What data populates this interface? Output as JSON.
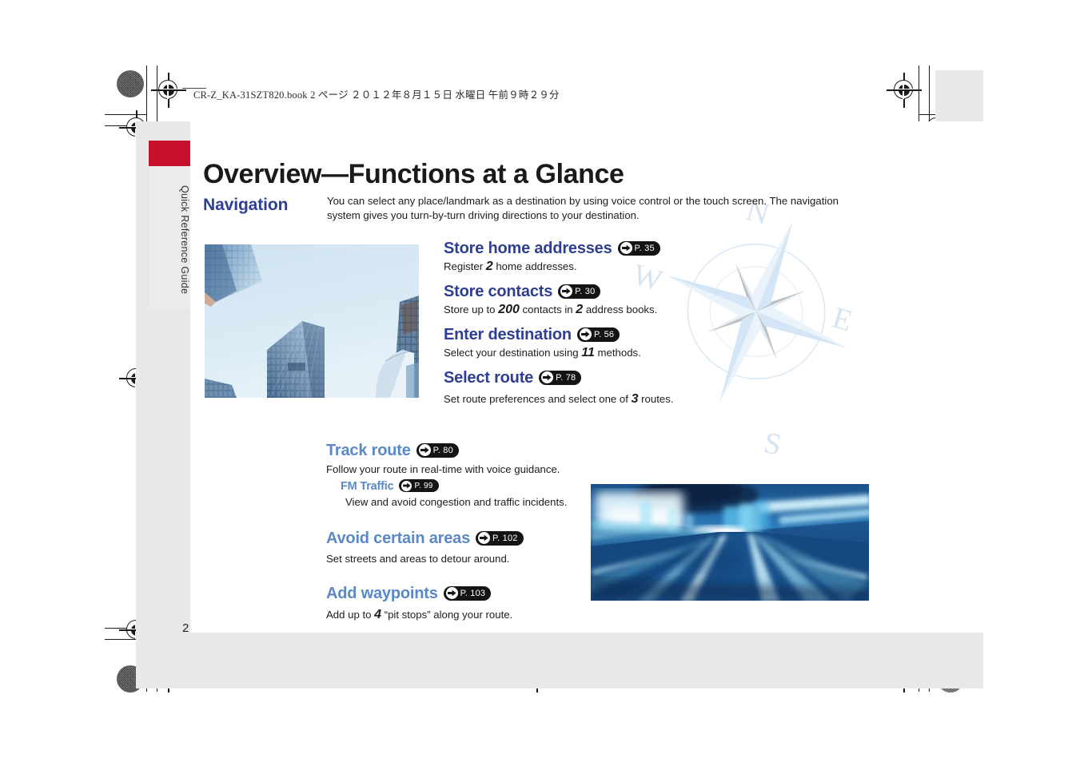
{
  "print_header": "CR-Z_KA-31SZT820.book   2 ページ   ２０１２年８月１５日   水曜日   午前９時２９分",
  "sidetab": {
    "label": "Quick Reference Guide",
    "accent_color": "#c8102e"
  },
  "page": {
    "title": "Overview—Functions at a Glance",
    "number": "2"
  },
  "section": {
    "title": "Navigation",
    "intro": "You can select any place/landmark as a destination by using voice control or the touch screen. The navigation system gives you turn-by-turn driving directions to your destination."
  },
  "colors": {
    "navy": "#2e3f92",
    "steel": "#5b88c6",
    "badge_bg": "#141414",
    "tab_red": "#c8102e"
  },
  "right_column": [
    {
      "heading": "Store home addresses",
      "page_ref": "P. 35",
      "desc_pre": "Register ",
      "desc_num": "2",
      "desc_post": " home addresses.",
      "style": "navy"
    },
    {
      "heading": "Store contacts",
      "page_ref": "P. 30",
      "desc_pre": "Store up to ",
      "desc_num": "200",
      "desc_mid": " contacts in ",
      "desc_num2": "2",
      "desc_post": " address books.",
      "style": "navy"
    },
    {
      "heading": "Enter destination",
      "page_ref": "P. 56",
      "desc_pre": "Select your destination using ",
      "desc_num": "11",
      "desc_post": " methods.",
      "style": "navy"
    },
    {
      "heading": "Select route",
      "page_ref": "P. 78",
      "desc_pre": "Set route preferences and select one of ",
      "desc_num": "3",
      "desc_post": " routes.",
      "style": "navy"
    }
  ],
  "lower_column": {
    "track_route": {
      "heading": "Track route",
      "page_ref": "P. 80",
      "desc": "Follow your route in real-time with voice guidance.",
      "sub": {
        "heading": "FM Traffic",
        "page_ref": "P. 99",
        "desc": "View and avoid congestion and traffic incidents."
      }
    },
    "avoid_areas": {
      "heading": "Avoid certain areas",
      "page_ref": "P. 102",
      "desc": "Set streets and areas to detour around."
    },
    "add_waypoints": {
      "heading": "Add waypoints",
      "page_ref": "P. 103",
      "desc_pre": "Add up to ",
      "desc_num": "4",
      "desc_post": " “pit stops” along your route."
    }
  },
  "photos": {
    "buildings_alt": "skyscrapers-from-below-photo",
    "tunnel_alt": "motion-blur-tunnel-drive-photo"
  },
  "compass": {
    "north": "N",
    "east": "E",
    "south": "S",
    "west": "W"
  }
}
